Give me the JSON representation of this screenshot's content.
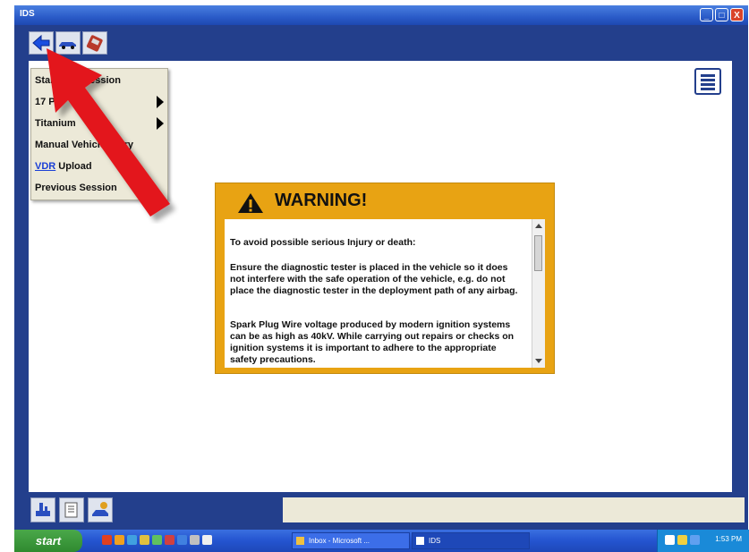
{
  "window": {
    "title": "IDS",
    "minimize": "_",
    "maximize": "□",
    "close": "X"
  },
  "toolbar": {
    "buttons": [
      "back-arrow-icon",
      "vehicle-icon",
      "tester-icon"
    ]
  },
  "menu": {
    "items": [
      {
        "label": "Start New Session",
        "submenu": false
      },
      {
        "label": "17 Pin",
        "submenu": true
      },
      {
        "label": "Titanium",
        "submenu": true
      },
      {
        "label": "Manual Vehicle Entry",
        "submenu": false
      },
      {
        "label_link": "VDR",
        "label_rest": " Upload",
        "submenu": false
      },
      {
        "label": "Previous Session",
        "submenu": false
      }
    ]
  },
  "warning": {
    "title": "WARNING!",
    "paragraphs": [
      "To avoid possible serious Injury or death:",
      "Ensure the diagnostic tester is placed in the vehicle so it does not interfere with the safe operation of the vehicle, e.g. do not place the diagnostic tester in the deployment path of any airbag.",
      "Spark Plug Wire voltage produced by modern ignition systems can be as high as 40kV. While carrying out repairs or checks on ignition systems it is important to adhere to the appropriate safety precautions."
    ]
  },
  "taskbar": {
    "start_label": "start",
    "tasks": [
      "Inbox - Microsoft ...",
      "IDS"
    ],
    "clock": "1:53 PM"
  },
  "colors": {
    "frame": "#233f8c",
    "warning": "#e8a313",
    "arrow": "#e3191f"
  }
}
